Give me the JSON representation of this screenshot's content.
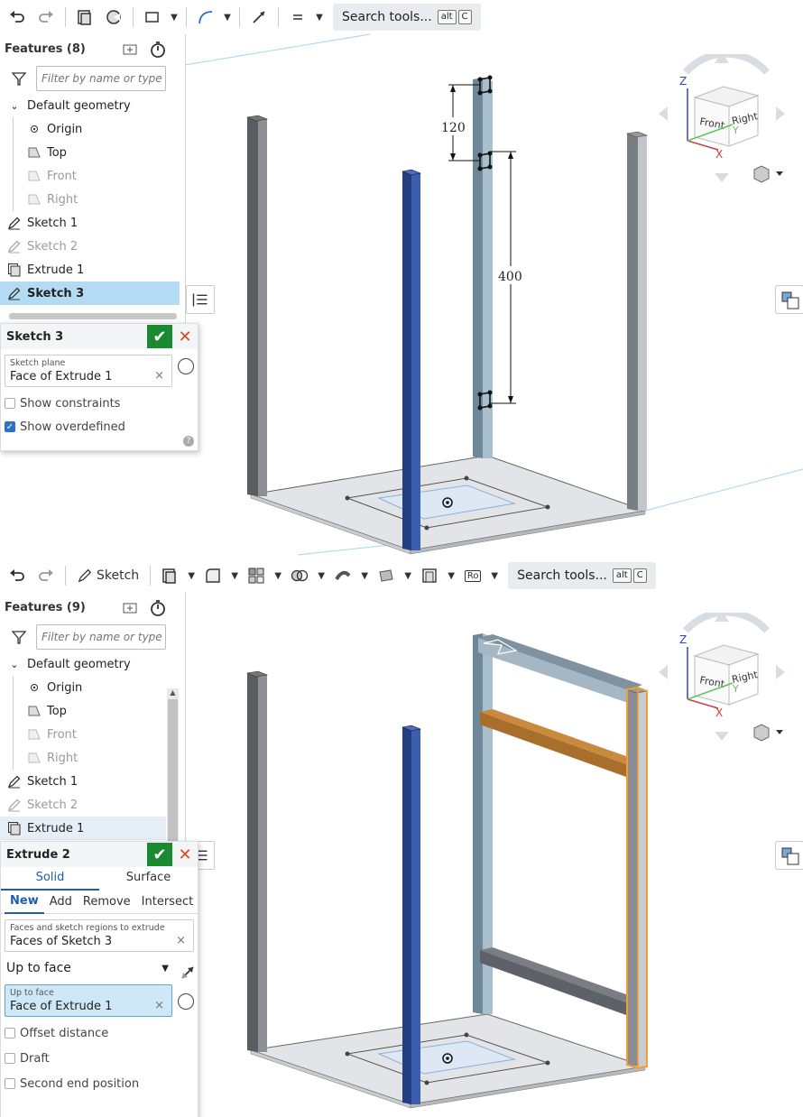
{
  "top": {
    "toolbar": {
      "search_label": "Search tools...",
      "kbd1": "alt",
      "kbd2": "C"
    },
    "features": {
      "title": "Features (8)",
      "filter_placeholder": "Filter by name or type"
    },
    "tree": [
      {
        "label": "Default geometry",
        "kind": "group"
      },
      {
        "label": "Origin",
        "kind": "origin"
      },
      {
        "label": "Top",
        "kind": "plane"
      },
      {
        "label": "Front",
        "kind": "plane-dim"
      },
      {
        "label": "Right",
        "kind": "plane-dim"
      },
      {
        "label": "Sketch 1",
        "kind": "sketch"
      },
      {
        "label": "Sketch 2",
        "kind": "sketch-dim"
      },
      {
        "label": "Extrude 1",
        "kind": "extrude"
      },
      {
        "label": "Sketch 3",
        "kind": "sketch-sel"
      }
    ],
    "dialog": {
      "title": "Sketch 3",
      "plane_label": "Sketch plane",
      "plane_value": "Face of Extrude 1",
      "show_constraints": "Show constraints",
      "show_overdefined": "Show overdefined"
    },
    "dims": {
      "d1": "120",
      "d2": "400"
    },
    "cube": {
      "front": "Front",
      "right": "Right",
      "z": "Z",
      "x": "X",
      "y": "Y"
    }
  },
  "bottom": {
    "toolbar": {
      "sketch_label": "Sketch",
      "ro_label": "Ro",
      "search_label": "Search tools...",
      "kbd1": "alt",
      "kbd2": "C"
    },
    "features": {
      "title": "Features (9)",
      "filter_placeholder": "Filter by name or type"
    },
    "tree": [
      {
        "label": "Default geometry",
        "kind": "group"
      },
      {
        "label": "Origin",
        "kind": "origin"
      },
      {
        "label": "Top",
        "kind": "plane"
      },
      {
        "label": "Front",
        "kind": "plane-dim"
      },
      {
        "label": "Right",
        "kind": "plane-dim"
      },
      {
        "label": "Sketch 1",
        "kind": "sketch"
      },
      {
        "label": "Sketch 2",
        "kind": "sketch-dim"
      },
      {
        "label": "Extrude 1",
        "kind": "extrude-hl"
      }
    ],
    "dialog": {
      "title": "Extrude 2",
      "tab_solid": "Solid",
      "tab_surface": "Surface",
      "op_new": "New",
      "op_add": "Add",
      "op_remove": "Remove",
      "op_intersect": "Intersect",
      "faces_label": "Faces and sketch regions to extrude",
      "faces_value": "Faces of Sketch 3",
      "end_type": "Up to face",
      "face_label": "Up to face",
      "face_value": "Face of Extrude 1",
      "offset": "Offset distance",
      "draft": "Draft",
      "second_end": "Second end position"
    },
    "cube": {
      "front": "Front",
      "right": "Right",
      "z": "Z",
      "x": "X",
      "y": "Y"
    }
  },
  "colors": {
    "accent": "#1d5fa8",
    "ok": "#1a8a31",
    "cancel": "#d8491f",
    "selected": "#b3dcf4",
    "highlight_blue": "#2d4f9e",
    "highlight_orange": "#f0a030"
  }
}
